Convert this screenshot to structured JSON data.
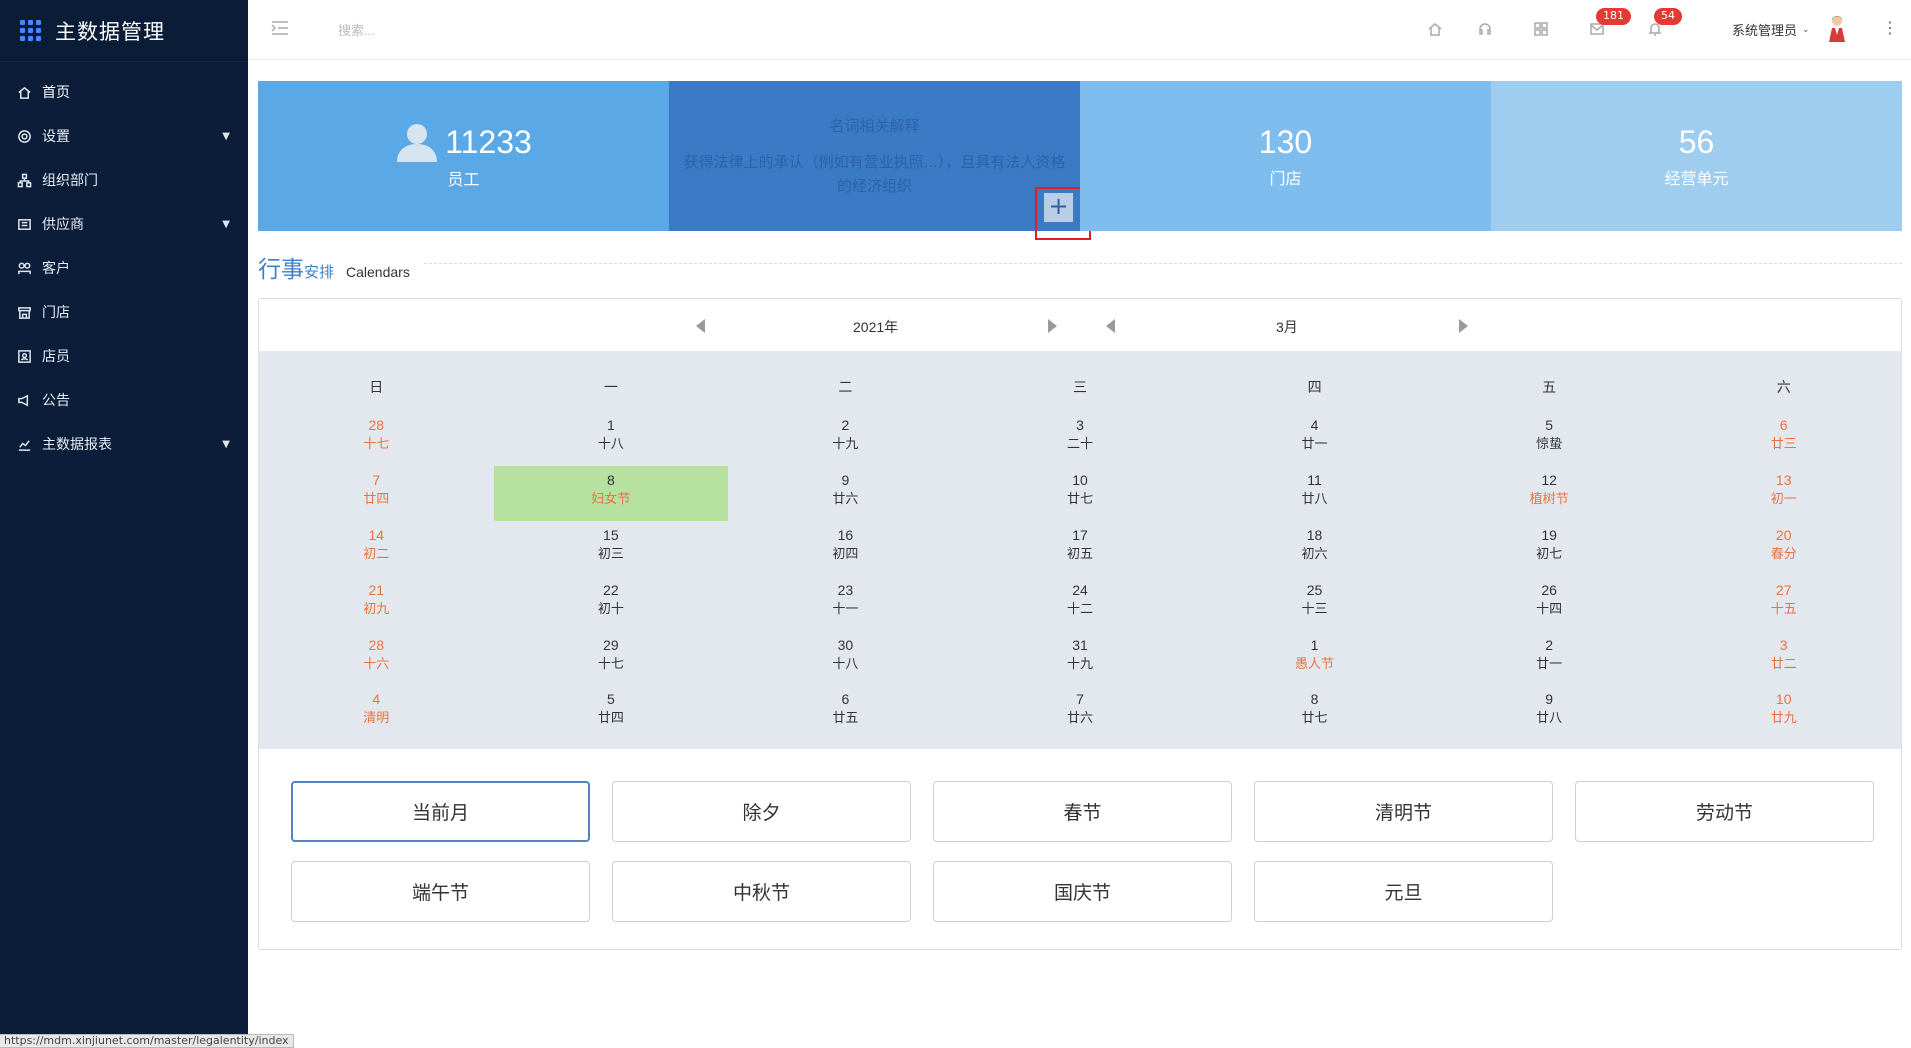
{
  "app": {
    "title": "主数据管理"
  },
  "sidebar": {
    "items": [
      {
        "label": "首页",
        "icon": "home-icon",
        "has_children": false
      },
      {
        "label": "设置",
        "icon": "gear-icon",
        "has_children": true
      },
      {
        "label": "组织部门",
        "icon": "org-icon",
        "has_children": false
      },
      {
        "label": "供应商",
        "icon": "supplier-icon",
        "has_children": true
      },
      {
        "label": "客户",
        "icon": "customer-icon",
        "has_children": false
      },
      {
        "label": "门店",
        "icon": "store-icon",
        "has_children": false
      },
      {
        "label": "店员",
        "icon": "clerk-icon",
        "has_children": false
      },
      {
        "label": "公告",
        "icon": "announcement-icon",
        "has_children": false
      },
      {
        "label": "主数据报表",
        "icon": "report-chart-icon",
        "has_children": true
      }
    ]
  },
  "status_url": "https://mdm.xinjiunet.com/master/legalentity/index",
  "topbar": {
    "search_placeholder": "搜索...",
    "badges": {
      "messages": "181",
      "notifications": "54"
    },
    "user_name": "系统管理员",
    "caret": "⌄",
    "more": "⋮"
  },
  "stats": {
    "employees": {
      "value": "11233",
      "label": "员工"
    },
    "legal": {
      "title": "名词相关解释",
      "text": "获得法律上的承认（例如有营业执照...），且具有法人资格的经济组织",
      "plus": "+"
    },
    "stores": {
      "value": "130",
      "label": "门店"
    },
    "units": {
      "value": "56",
      "label": "经营单元"
    }
  },
  "section": {
    "title_big": "行事",
    "title_small": "安排",
    "subtitle": "Calendars"
  },
  "calendar": {
    "year_label": "2021年",
    "month_label": "3月",
    "weekdays": [
      "日",
      "一",
      "二",
      "三",
      "四",
      "五",
      "六"
    ],
    "weeks": [
      [
        [
          "28",
          "十七"
        ],
        [
          "1",
          "十八"
        ],
        [
          "2",
          "十九"
        ],
        [
          "3",
          "二十"
        ],
        [
          "4",
          "廿一"
        ],
        [
          "5",
          "惊蛰"
        ],
        [
          "6",
          "廿三"
        ]
      ],
      [
        [
          "7",
          "廿四"
        ],
        [
          "8",
          "妇女节"
        ],
        [
          "9",
          "廿六"
        ],
        [
          "10",
          "廿七"
        ],
        [
          "11",
          "廿八"
        ],
        [
          "12",
          "植树节"
        ],
        [
          "13",
          "初一"
        ]
      ],
      [
        [
          "14",
          "初二"
        ],
        [
          "15",
          "初三"
        ],
        [
          "16",
          "初四"
        ],
        [
          "17",
          "初五"
        ],
        [
          "18",
          "初六"
        ],
        [
          "19",
          "初七"
        ],
        [
          "20",
          "春分"
        ]
      ],
      [
        [
          "21",
          "初九"
        ],
        [
          "22",
          "初十"
        ],
        [
          "23",
          "十一"
        ],
        [
          "24",
          "十二"
        ],
        [
          "25",
          "十三"
        ],
        [
          "26",
          "十四"
        ],
        [
          "27",
          "十五"
        ]
      ],
      [
        [
          "28",
          "十六"
        ],
        [
          "29",
          "十七"
        ],
        [
          "30",
          "十八"
        ],
        [
          "31",
          "十九"
        ],
        [
          "1",
          "愚人节"
        ],
        [
          "2",
          "廿一"
        ],
        [
          "3",
          "廿二"
        ]
      ],
      [
        [
          "4",
          "清明"
        ],
        [
          "5",
          "廿四"
        ],
        [
          "6",
          "廿五"
        ],
        [
          "7",
          "廿六"
        ],
        [
          "8",
          "廿七"
        ],
        [
          "9",
          "廿八"
        ],
        [
          "10",
          "廿九"
        ]
      ]
    ],
    "today": "3-8",
    "festivals": [
      "2-1",
      "4-5"
    ],
    "holiday_buttons": [
      "当前月",
      "除夕",
      "春节",
      "清明节",
      "劳动节",
      "端午节",
      "中秋节",
      "国庆节",
      "元旦"
    ]
  },
  "colors": {
    "sidebar_bg": "#0b1d38",
    "accent": "#3f7fc9",
    "weekend": "#e87340",
    "today_bg": "#b6e19f",
    "badge": "#e53935"
  }
}
